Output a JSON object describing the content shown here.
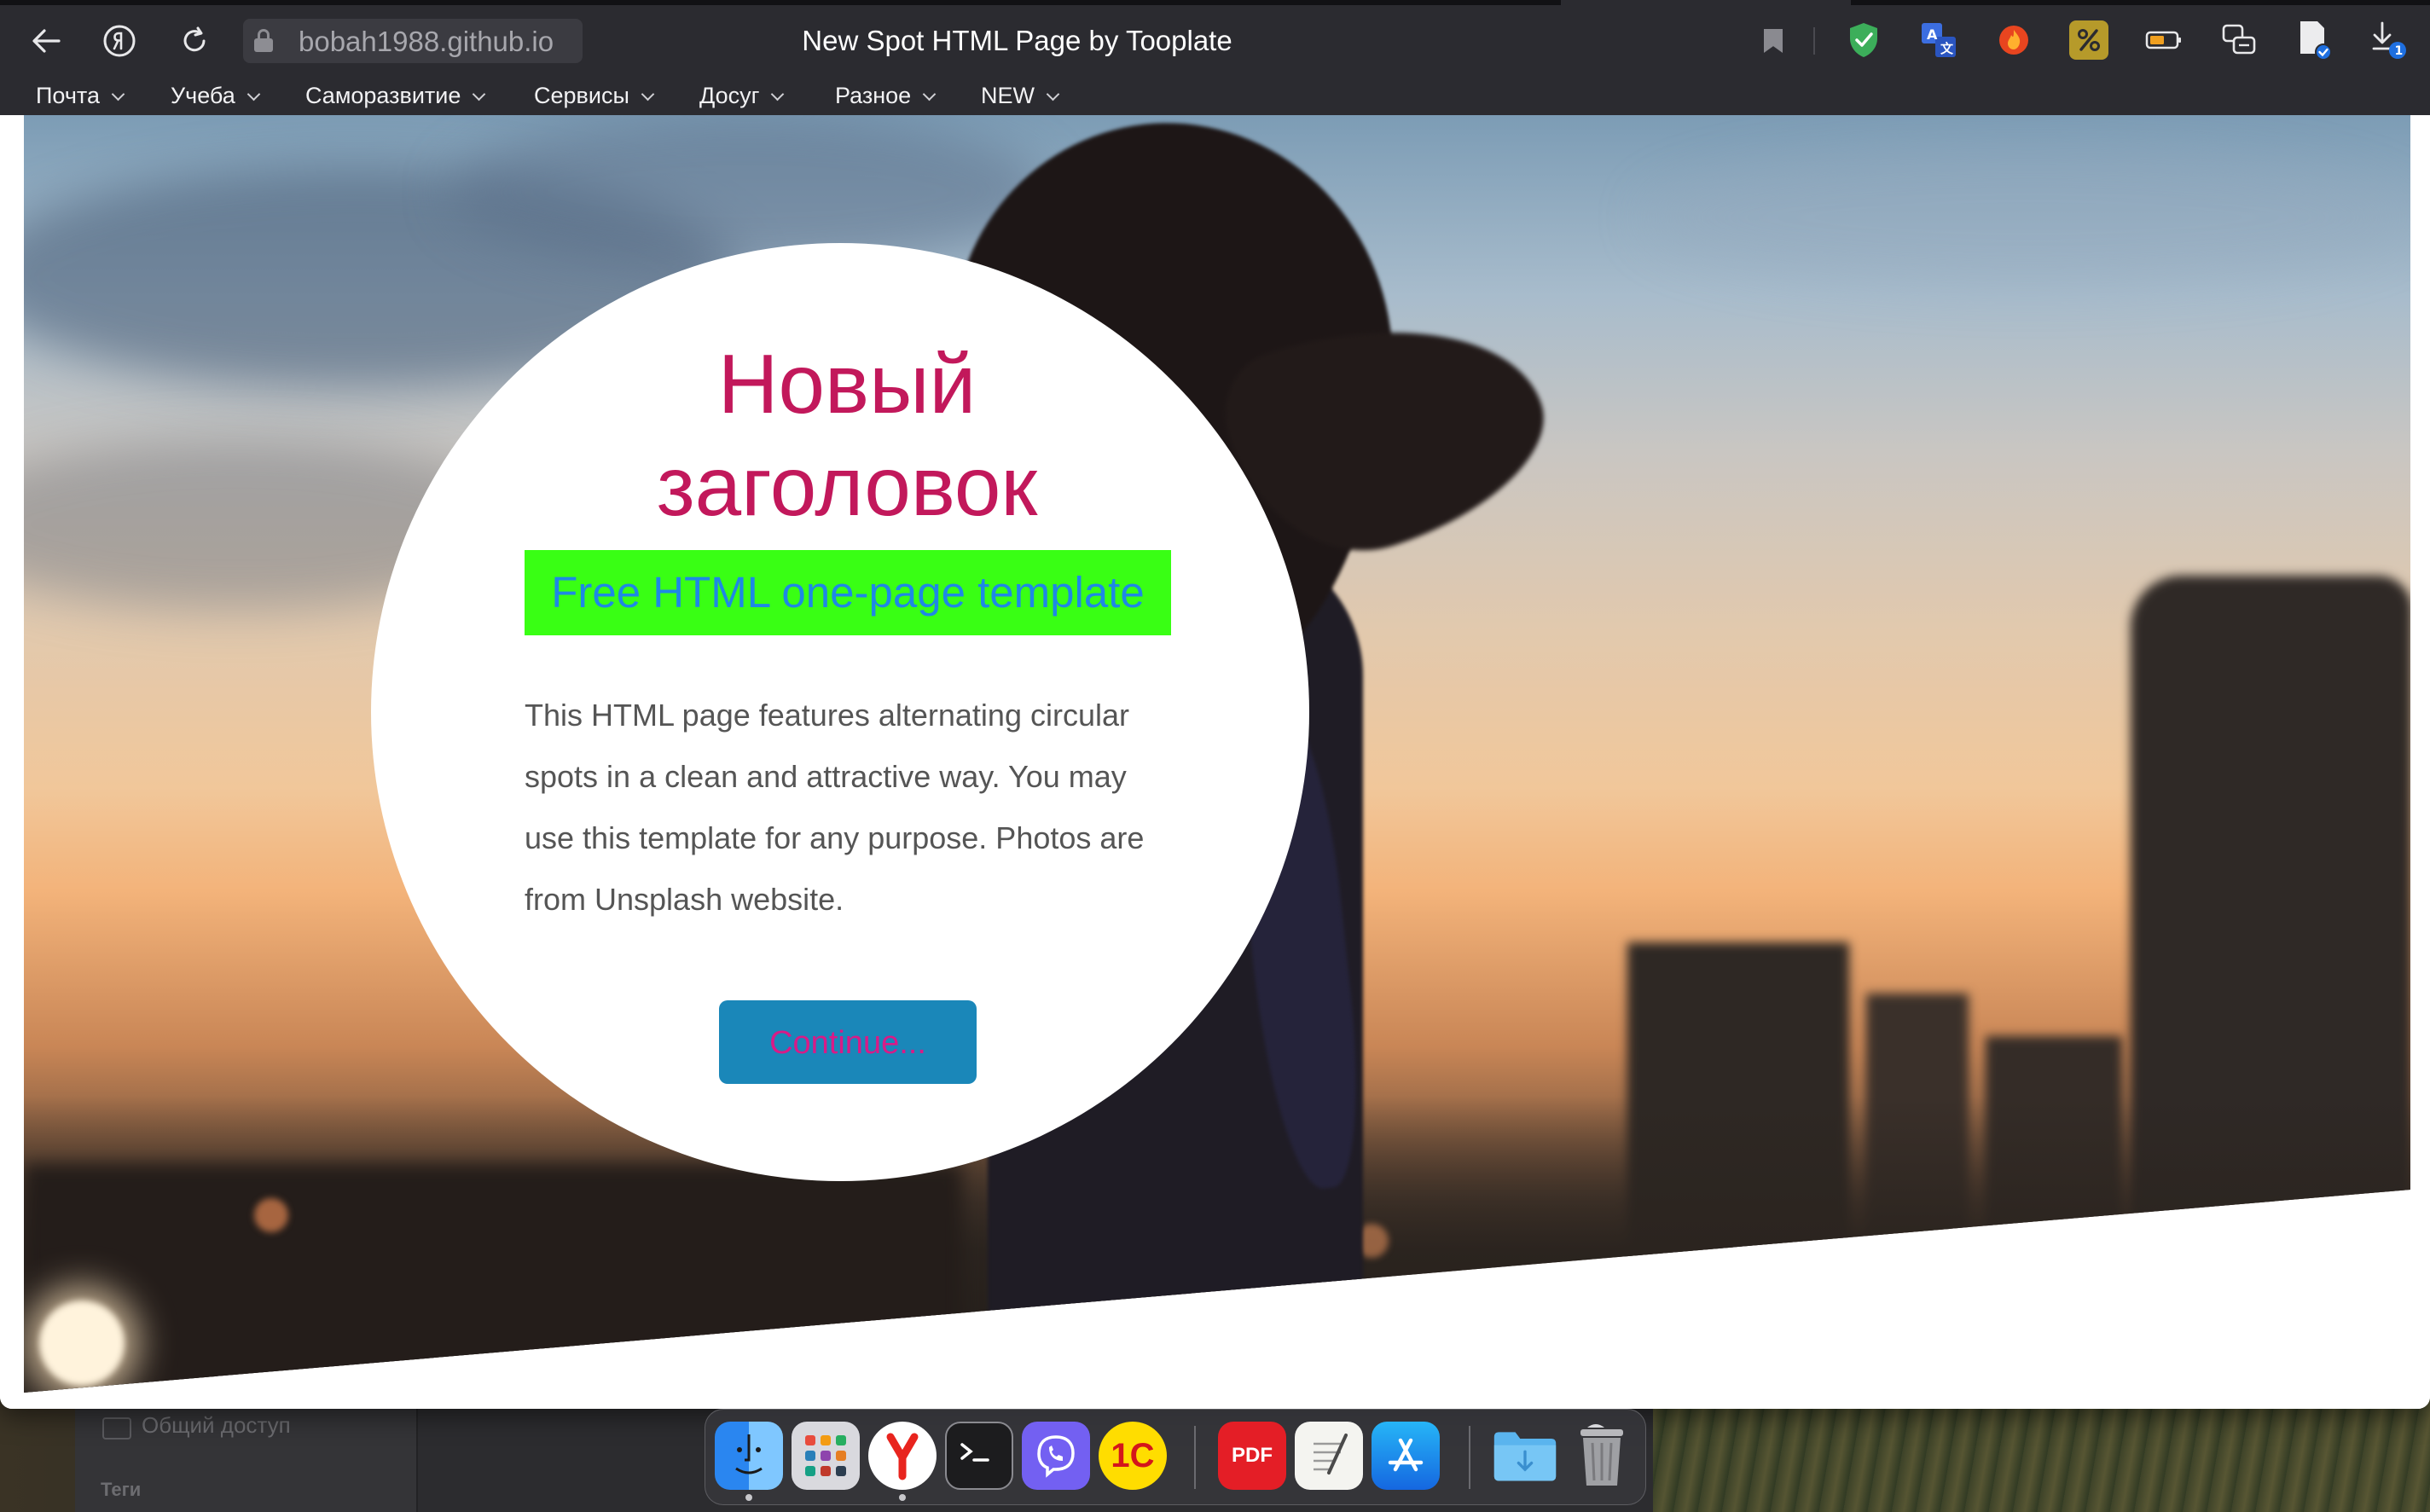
{
  "browser": {
    "address": "bobah1988.github.io",
    "tab_title": "New Spot HTML Page by Tooplate",
    "download_badge": "1",
    "menu": [
      {
        "label": "Почта"
      },
      {
        "label": "Учеба"
      },
      {
        "label": "Саморазвитие"
      },
      {
        "label": "Сервисы"
      },
      {
        "label": "Досуг"
      },
      {
        "label": "Разное"
      },
      {
        "label": "NEW"
      }
    ],
    "extension_icons": [
      "shield-check-icon",
      "translate-icon",
      "fire-icon",
      "percent-icon",
      "battery-icon",
      "chat-translate-icon",
      "bookmark-check-icon",
      "download-icon"
    ]
  },
  "page": {
    "title": "Новый заголовок",
    "subtitle": "Free HTML one-page template",
    "description": "This HTML page features alternating circular spots in a clean and attractive way. You may use this template for any purpose. Photos are from Unsplash website.",
    "continue_label": "Continue...",
    "colors": {
      "title": "#c2185b",
      "subtitle_bg": "#39ff14",
      "subtitle_text": "#1e88e5",
      "button_bg": "#1a87b9",
      "button_text": "#d81b87"
    }
  },
  "background_window": {
    "sidebar_item": "Общий доступ",
    "section_label": "Теги"
  },
  "dock": {
    "apps": [
      "Finder",
      "Launchpad",
      "Yandex Browser",
      "Terminal",
      "Viber",
      "1C",
      "PDF Editor",
      "TextEdit",
      "App Store",
      "Downloads Folder",
      "Trash"
    ],
    "pdf_label": "PDF",
    "onec_label": "1С"
  }
}
